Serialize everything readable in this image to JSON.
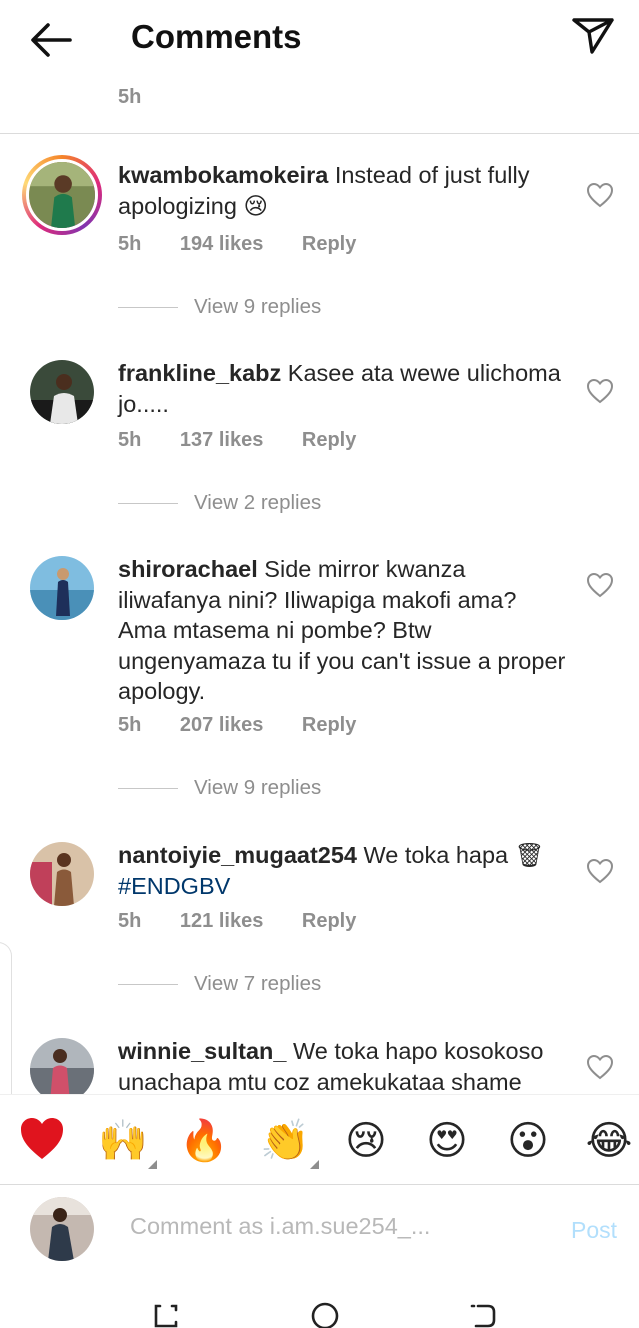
{
  "header": {
    "title": "Comments"
  },
  "caption": {
    "time": "5h"
  },
  "comments": [
    {
      "username": "kwambokamokeira",
      "text": "Instead of just fully apologizing",
      "emoji": "😢",
      "time": "5h",
      "likes": "194 likes",
      "reply": "Reply",
      "view_replies": "View 9 replies"
    },
    {
      "username": "frankline_kabz",
      "text": "Kasee ata wewe ulichoma jo.....",
      "time": "5h",
      "likes": "137 likes",
      "reply": "Reply",
      "view_replies": "View 2 replies"
    },
    {
      "username": "shirorachael",
      "text": "Side mirror kwanza iliwafanya nini? Iliwapiga makofi ama? Ama mtasema ni pombe? Btw ungenyamaza tu if you can't issue a proper apology.",
      "time": "5h",
      "likes": "207 likes",
      "reply": "Reply",
      "view_replies": "View 9 replies"
    },
    {
      "username": "nantoiyie_mugaat254",
      "text": "We toka hapa",
      "emoji": "🗑",
      "hashtag": "#ENDGBV",
      "time": "5h",
      "likes": "121 likes",
      "reply": "Reply",
      "view_replies": "View 7 replies"
    },
    {
      "username": "winnie_sultan_",
      "text": "We toka hapo kosokoso unachapa mtu coz amekukataa shame"
    }
  ],
  "emoji_bar": [
    "❤️",
    "🙌",
    "🔥",
    "👏",
    "😢",
    "😍",
    "😮",
    "😂"
  ],
  "comment_bar": {
    "placeholder": "Comment as i.am.sue254_...",
    "post_label": "Post"
  },
  "colors": {
    "link": "#00376b",
    "secondary_text": "#8e8e8e",
    "post_disabled": "#b2dffc",
    "heart_red": "#ed4956"
  },
  "icons": {
    "back": "arrow-left-icon",
    "send": "paper-plane-icon",
    "like": "heart-outline-icon"
  }
}
